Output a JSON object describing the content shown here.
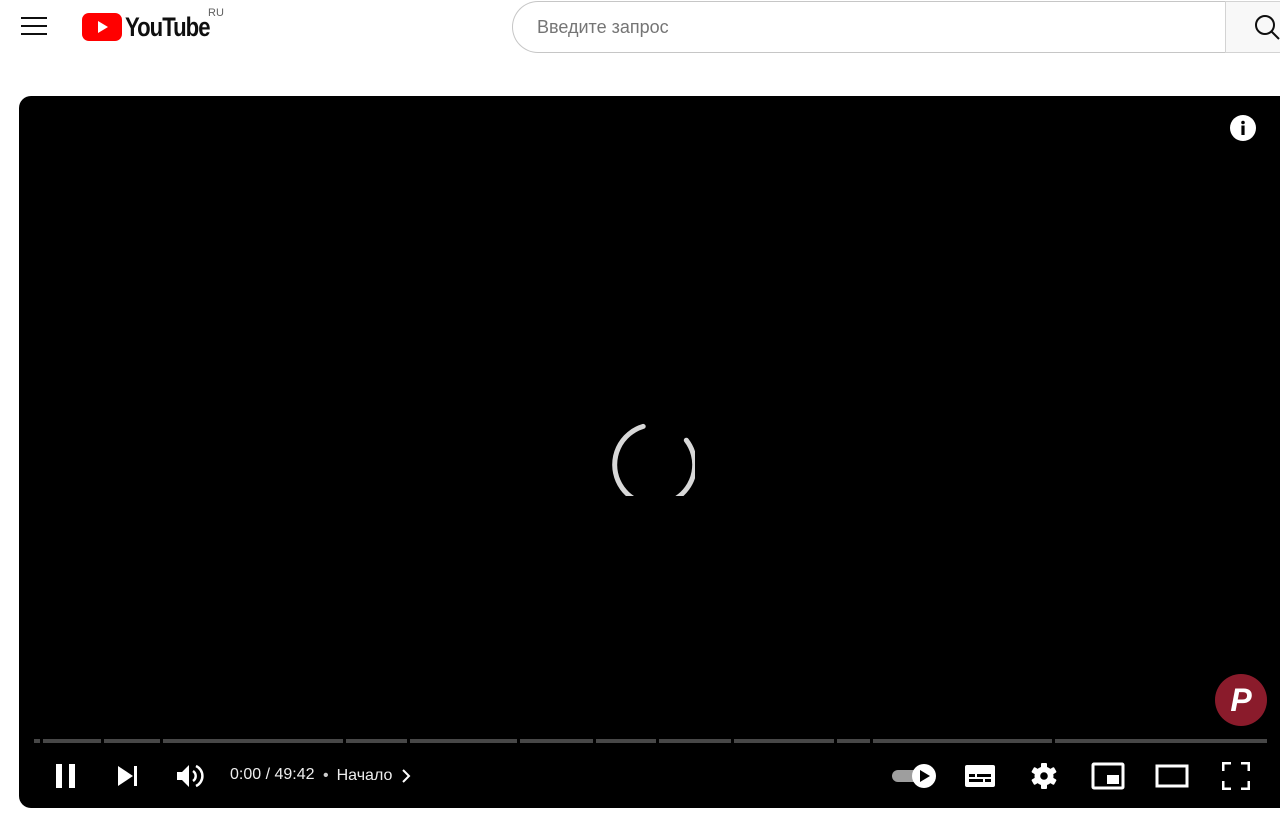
{
  "masthead": {
    "logo_text": "YouTube",
    "country_code": "RU",
    "search": {
      "placeholder": "Введите запрос",
      "value": ""
    }
  },
  "player": {
    "current_time": "0:00",
    "duration": "49:42",
    "time_separator": " / ",
    "chapter_title": "Начало",
    "state": "loading",
    "progress_fraction": 0,
    "autoplay_enabled": true,
    "channel_badge_letter": "P",
    "colors": {
      "brand_red": "#ff0000",
      "player_bg": "#000000",
      "badge_bg": "#8a1b2b"
    },
    "controls_left": [
      "pause-icon",
      "next-icon",
      "volume-icon"
    ],
    "controls_right": [
      "autoplay-toggle-icon",
      "subtitles-icon",
      "settings-gear-icon",
      "miniplayer-icon",
      "theater-mode-icon",
      "fullscreen-icon"
    ]
  }
}
